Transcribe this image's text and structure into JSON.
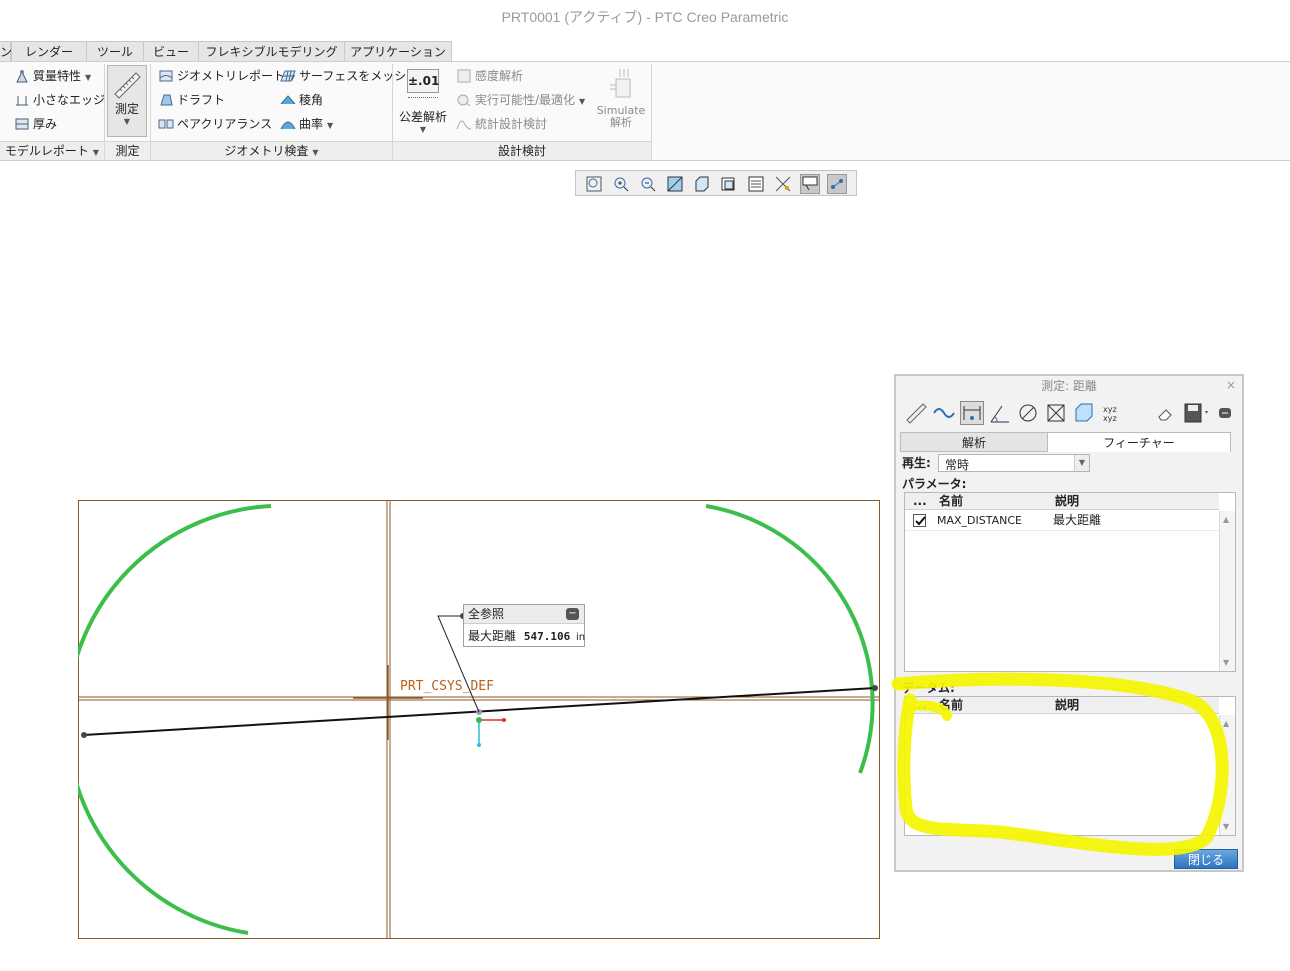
{
  "window": {
    "title": "PRT0001 (アクティブ) - PTC Creo Parametric"
  },
  "ribbon_tabs": [
    {
      "label": "ン"
    },
    {
      "label": "レンダー"
    },
    {
      "label": "ツール"
    },
    {
      "label": "ビュー"
    },
    {
      "label": "フレキシブルモデリング"
    },
    {
      "label": "アプリケーション"
    }
  ],
  "ribbon": {
    "model_report": {
      "mass_props": "質量特性",
      "short_edge": "小さなエッジ",
      "thickness": "厚み",
      "footer": "モデルレポート"
    },
    "measure": {
      "button": "測定",
      "footer": "測定"
    },
    "geometry_check": {
      "geometry_report": "ジオメトリレポート",
      "draft": "ドラフト",
      "pair_clearance": "ペアクリアランス",
      "mesh_surface": "サーフェスをメッシュ",
      "dihedral": "稜角",
      "curvature": "曲率",
      "footer": "ジオメトリ検査"
    },
    "design_study": {
      "tolerance_icon": "±.01",
      "tolerance": "公差解析",
      "sensitivity": "感度解析",
      "feasibility": "実行可能性/最適化",
      "statistical": "統計設計検討",
      "simulate_line1": "Simulate",
      "simulate_line2": "解析",
      "footer": "設計検討"
    }
  },
  "graphics": {
    "csys_label": "PRT_CSYS_DEF",
    "popup": {
      "title": "全参照",
      "label": "最大距離",
      "value": "547.106",
      "unit": "in"
    }
  },
  "dialog": {
    "title": "測定: 距離",
    "close": "×",
    "tabs": [
      "解析",
      "フィーチャー"
    ],
    "regen_label": "再生:",
    "regen_value": "常時",
    "params_label": "パラメータ:",
    "params_headers": [
      "...",
      "名前",
      "説明"
    ],
    "params_rows": [
      {
        "checked": true,
        "name": "MAX_DISTANCE",
        "desc": "最大距離"
      }
    ],
    "datum_label": "データム:",
    "datum_headers": [
      "...",
      "名前",
      "説明"
    ],
    "close_button": "閉じる"
  },
  "colors": {
    "arc_green": "#3cbf4a",
    "highlight_yellow": "#f5f500",
    "frame_brown": "#8b5a2b"
  }
}
